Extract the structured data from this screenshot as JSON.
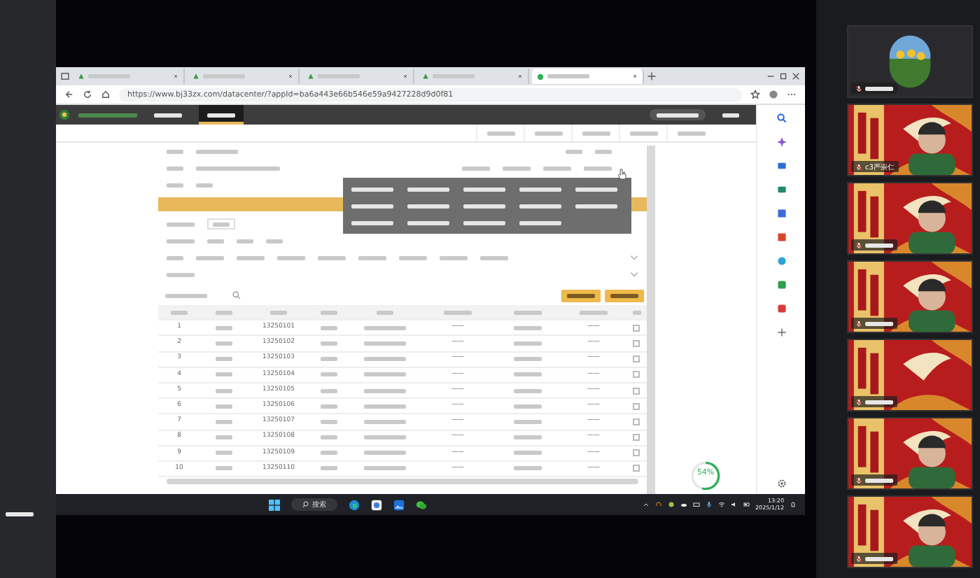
{
  "browser": {
    "tabs": [
      {
        "selected": false
      },
      {
        "selected": false
      },
      {
        "selected": false
      },
      {
        "selected": false
      },
      {
        "selected": true
      }
    ],
    "url": "https://www.bj33zx.com/datacenter/?appId=ba6a443e66b546e59a9427228d9d0f81"
  },
  "table": {
    "rows": [
      {
        "no": "1",
        "student_id": "13250101",
        "column_6": "——",
        "column_8": "——"
      },
      {
        "no": "2",
        "student_id": "13250102",
        "column_6": "——",
        "column_8": "——"
      },
      {
        "no": "3",
        "student_id": "13250103",
        "column_6": "——",
        "column_8": "——"
      },
      {
        "no": "4",
        "student_id": "13250104",
        "column_6": "——",
        "column_8": "——"
      },
      {
        "no": "5",
        "student_id": "13250105",
        "column_6": "——",
        "column_8": "——"
      },
      {
        "no": "6",
        "student_id": "13250106",
        "column_6": "——",
        "column_8": "——"
      },
      {
        "no": "7",
        "student_id": "13250107",
        "column_6": "——",
        "column_8": "——"
      },
      {
        "no": "8",
        "student_id": "13250108",
        "column_6": "——",
        "column_8": "——"
      },
      {
        "no": "9",
        "student_id": "13250109",
        "column_6": "——",
        "column_8": "——"
      },
      {
        "no": "10",
        "student_id": "13250110",
        "column_6": "——",
        "column_8": "——"
      }
    ]
  },
  "app_nav": [
    {
      "selected": false
    },
    {
      "selected": true
    }
  ],
  "progress": {
    "reading": "54%",
    "level": 0.54
  },
  "taskbar": {
    "search": "搜索",
    "time": "13:20",
    "date": "2025/1/12"
  },
  "participants": [
    {
      "kind": "screen",
      "muted": true
    },
    {
      "kind": "camera",
      "muted": true,
      "name": "c3严崇仁"
    },
    {
      "kind": "camera",
      "muted": true
    },
    {
      "kind": "camera",
      "muted": true
    },
    {
      "kind": "poster",
      "muted": true
    },
    {
      "kind": "camera",
      "muted": true
    },
    {
      "kind": "camera",
      "muted": true
    }
  ]
}
